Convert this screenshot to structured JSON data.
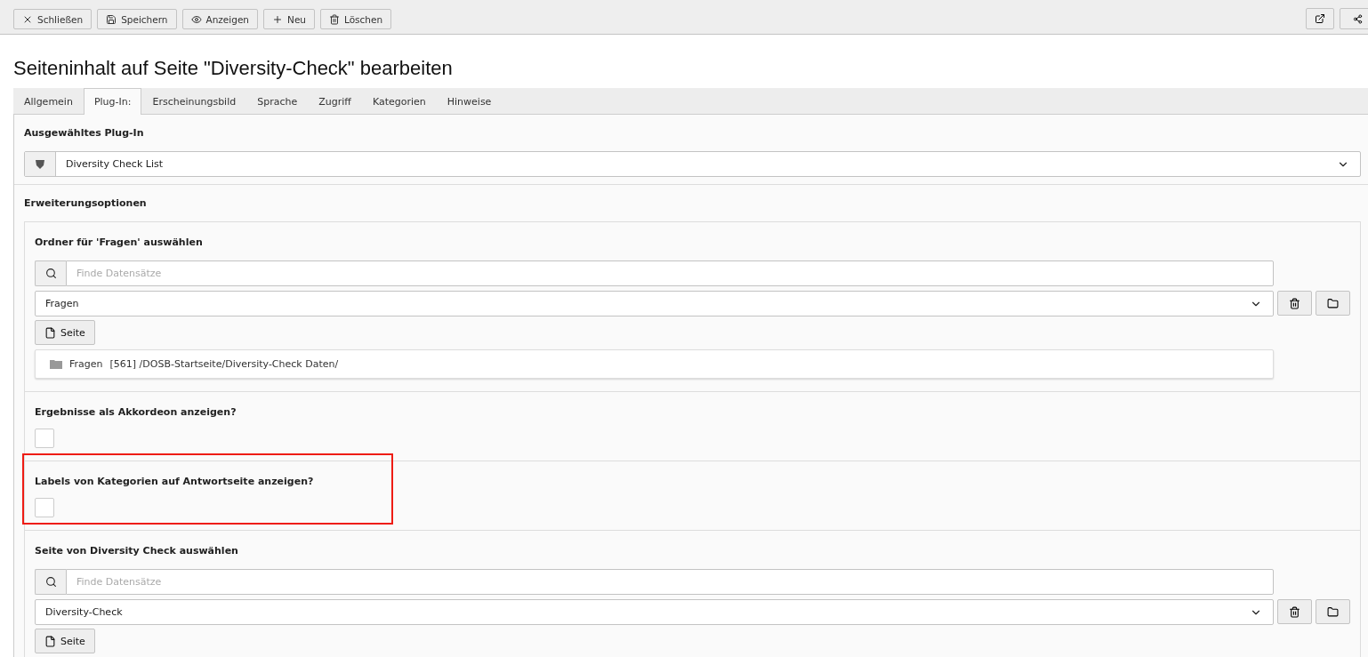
{
  "toolbar": {
    "buttons": [
      {
        "kind": "close",
        "label": "Schließen"
      },
      {
        "kind": "save",
        "label": "Speichern"
      },
      {
        "kind": "view",
        "label": "Anzeigen"
      },
      {
        "kind": "new",
        "label": "Neu"
      },
      {
        "kind": "delete",
        "label": "Löschen"
      }
    ]
  },
  "title": "Seiteninhalt auf Seite \"Diversity-Check\" bearbeiten",
  "tabs": [
    {
      "label": "Allgemein",
      "selected": false
    },
    {
      "label": "Plug-In:",
      "selected": true
    },
    {
      "label": "Erscheinungsbild",
      "selected": false
    },
    {
      "label": "Sprache",
      "selected": false
    },
    {
      "label": "Zugriff",
      "selected": false
    },
    {
      "label": "Kategorien",
      "selected": false
    },
    {
      "label": "Hinweise",
      "selected": false
    }
  ],
  "plugin": {
    "label": "Ausgewähltes Plug-In",
    "value": "Diversity Check List"
  },
  "options": {
    "label": "Erweiterungsoptionen",
    "fields": [
      {
        "kind": "relation",
        "label": "Ordner für 'Fragen' auswählen",
        "placeholder": "Finde Datensätze",
        "value": "Fragen",
        "button": "Seite",
        "records": [
          {
            "title": "Fragen",
            "uid": "[561]",
            "path": "/DOSB-Startseite/Diversity-Check Daten/"
          }
        ],
        "highlighted": false
      },
      {
        "kind": "checkbox",
        "label": "Ergebnisse als Akkordeon anzeigen?",
        "checked": false,
        "highlighted": false
      },
      {
        "kind": "checkbox",
        "label": "Labels von Kategorien auf Antwortseite anzeigen?",
        "checked": false,
        "highlighted": true
      },
      {
        "kind": "relation",
        "label": "Seite von Diversity Check auswählen",
        "placeholder": "Finde Datensätze",
        "value": "Diversity-Check",
        "button": "Seite",
        "highlighted": false
      }
    ]
  }
}
